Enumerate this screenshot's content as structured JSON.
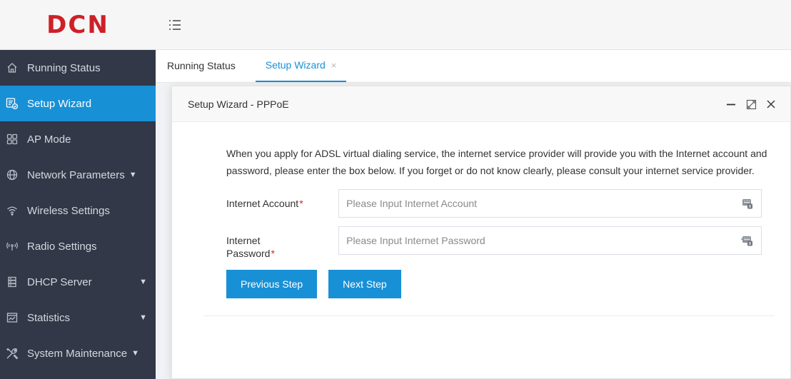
{
  "brand": {
    "logo_text": "DCN",
    "color": "#cf2027"
  },
  "colors": {
    "accent": "#1890d6",
    "sidebar_bg": "#323847",
    "required": "#e02020"
  },
  "sidebar": {
    "items": [
      {
        "label": "Running Status",
        "icon": "home-icon"
      },
      {
        "label": "Setup Wizard",
        "icon": "wizard-icon",
        "active": true
      },
      {
        "label": "AP Mode",
        "icon": "grid-icon"
      },
      {
        "label": "Network Parameters",
        "icon": "globe-icon",
        "has_caret": true
      },
      {
        "label": "Wireless Settings",
        "icon": "wifi-icon"
      },
      {
        "label": "Radio Settings",
        "icon": "radio-icon"
      },
      {
        "label": "DHCP Server",
        "icon": "server-icon",
        "has_caret": true
      },
      {
        "label": "Statistics",
        "icon": "chart-icon",
        "has_caret": true
      },
      {
        "label": "System Maintenance",
        "icon": "tools-icon",
        "has_caret": true
      }
    ]
  },
  "tabs": [
    {
      "label": "Running Status"
    },
    {
      "label": "Setup Wizard",
      "active": true,
      "close": "×"
    }
  ],
  "modal": {
    "title": "Setup Wizard - PPPoE",
    "description": "When you apply for ADSL virtual dialing service, the internet service provider will provide you with the Internet account and password, please enter the box below. If you forget or do not know clearly, please consult your internet service provider.",
    "fields": {
      "account": {
        "label": "Internet Account",
        "required_mark": "*",
        "value": "",
        "placeholder": "Please Input Internet Account"
      },
      "password": {
        "label_line1": "Internet",
        "label_line2": "Password",
        "required_mark": "*",
        "value": "",
        "placeholder": "Please Input Internet Password"
      }
    },
    "buttons": {
      "previous": "Previous Step",
      "next": "Next Step"
    }
  }
}
